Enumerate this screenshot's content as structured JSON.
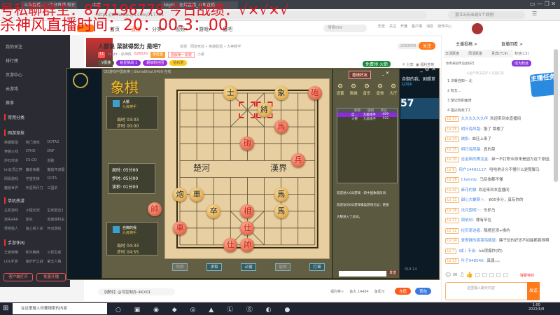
{
  "browser": {
    "tabs": [
      "斗鱼直播 - 一个好直播 就在斗鱼",
      "收藏",
      "Night - 在线直播_斗鱼直播"
    ],
    "url": "https://www.douyu.com/217785",
    "search_placeholder": "浙江6天出现5个病例"
  },
  "overlay": {
    "line1": "号私聊群主：877196778  今日战绩：√×√×√",
    "line2": "杀神风直播时间：20：00-3：00"
  },
  "site": {
    "nav": [
      "首页",
      "直播",
      "分类▾",
      "视频▾",
      "游戏▾",
      "鱼吧"
    ],
    "search_placeholder": "搜索666",
    "icons": [
      "历史",
      "关注",
      "开播",
      "客户端",
      "消息",
      "创作中心"
    ]
  },
  "sidebar": {
    "items": [
      "我的关注",
      "排行榜",
      "页游中心",
      "云游戏",
      "赛事"
    ],
    "sections": [
      {
        "title": "常用分类",
        "more": "展开"
      },
      {
        "title": "网游竞技",
        "more": "全部",
        "items": [
          "英雄联盟",
          "热门游戏",
          "DOTA2",
          "穿越火线",
          "CFHD",
          "DNF",
          "炉石传说",
          "CS:GO",
          "逃跑",
          "lol云顶之弈",
          "魔兽争霸",
          "魔兽怀旧服",
          "网易游戏",
          "守望先锋",
          "DOTA",
          "魔兽世界",
          "天涯明月刀",
          "三国杀"
        ]
      },
      {
        "title": "单机热游",
        "more": "全部",
        "items": [
          "主机游戏",
          "小程无间",
          "生死狙击2",
          "迷失ARK",
          "迷失",
          "逃离塔科夫",
          "怪物猎人",
          "海上捞人杀",
          "怀旧游戏"
        ]
      },
      {
        "title": "手游休闲",
        "more": "全部",
        "items": [
          "王者荣耀",
          "和平精英",
          "火影忍者",
          "LOL手游",
          "金铲铲之战",
          "第五人格"
        ]
      }
    ],
    "buttons": [
      "客户端打开",
      "批量开播"
    ]
  },
  "streamer": {
    "title": "人都说 菜就得努力 是吧？",
    "tag": "举报",
    "category": "网游竞技 • 英雄联盟 • 大神教学",
    "level": "11",
    "name": "Night - 杀神风",
    "hot": "826026",
    "badges": [
      "亲密度",
      "国服第一雷霆"
    ],
    "rank": "小桌",
    "room_id": "2002649",
    "follow": "关注",
    "pills": [
      "V贵族",
      "粘星挑战 1",
      "超级粉丝团",
      "钻石票"
    ],
    "free_gift": "免费领",
    "fire": "火箭",
    "share": "分享",
    "report": "福利签到"
  },
  "chess": {
    "window_title": "QQ游戏中国象棋 | Gloria0thul.0409 在线",
    "logo": "象棋",
    "invite": "邀请好友",
    "top_player": {
      "name": "大鬃",
      "rank": "九级棋手",
      "total_label": "局时",
      "total": "03:03",
      "step_label": "步时",
      "step": "00:00"
    },
    "rules": [
      {
        "label": "局时:",
        "value": "05分00"
      },
      {
        "label": "步时:",
        "value": "05分00"
      },
      {
        "label": "读秒:",
        "value": "01分00"
      }
    ],
    "bottom_player": {
      "name": "自御的我",
      "rank": "九级棋手",
      "total_label": "局时",
      "total": "04:33",
      "step_label": "步时",
      "step": "04:55"
    },
    "river": [
      "楚河",
      "漢界"
    ],
    "captured": [
      {
        "char": "帥",
        "color": "red"
      }
    ],
    "pieces": [
      {
        "c": "士",
        "s": "black",
        "col": 3,
        "row": 0
      },
      {
        "c": "象",
        "s": "black",
        "col": 6,
        "row": 0
      },
      {
        "c": "砲",
        "s": "red",
        "col": 8,
        "row": 0
      },
      {
        "c": "將",
        "s": "black",
        "col": 5,
        "row": 1
      },
      {
        "c": "馬",
        "s": "red",
        "col": 6,
        "row": 2
      },
      {
        "c": "砲",
        "s": "red",
        "col": 4,
        "row": 3
      },
      {
        "c": "兵",
        "s": "red",
        "col": 7,
        "row": 4
      },
      {
        "c": "炮",
        "s": "black",
        "col": 0,
        "row": 6
      },
      {
        "c": "車",
        "s": "black",
        "col": 1,
        "row": 6
      },
      {
        "c": "馬",
        "s": "black",
        "col": 6,
        "row": 6
      },
      {
        "c": "卒",
        "s": "black",
        "col": 2,
        "row": 7
      },
      {
        "c": "相",
        "s": "red",
        "col": 4,
        "row": 7
      },
      {
        "c": "馬",
        "s": "black",
        "col": 6,
        "row": 7
      },
      {
        "c": "車",
        "s": "red",
        "col": 0,
        "row": 8
      },
      {
        "c": "仕",
        "s": "red",
        "col": 4,
        "row": 8
      },
      {
        "c": "仕",
        "s": "red",
        "col": 3,
        "row": 9
      },
      {
        "c": "帥",
        "s": "red",
        "col": 4,
        "row": 9
      }
    ],
    "last_move": [
      {
        "col": 4,
        "row": 1
      },
      {
        "col": 5,
        "row": 1
      }
    ],
    "buttons": [
      {
        "label": "悔棋",
        "enabled": false
      },
      {
        "label": "求和",
        "enabled": true
      },
      {
        "label": "认输",
        "enabled": true
      },
      {
        "label": "催棋",
        "enabled": false
      },
      {
        "label": "打谱",
        "enabled": true
      }
    ],
    "tools": [
      "设置",
      "商城",
      "音乐",
      "音效",
      "大厅"
    ],
    "table_headers": [
      "昵称",
      "级别",
      "积分"
    ],
    "players": [
      {
        "name": "自...",
        "rank": "九级棋手",
        "score": "-409"
      },
      {
        "name": "大鬃",
        "rank": "九级棋手",
        "score": "-502"
      }
    ],
    "messages": [
      "欢迎进入QQ游戏 - 新中国象棋房间",
      "欢迎访问QQ游戏棋类游戏论坛：链接",
      "大鬃进入了房间。"
    ],
    "send": "发送"
  },
  "lol": {
    "friend": "自御的我、剧踢草",
    "status": "队列中",
    "timer": "57",
    "footer": "918.14"
  },
  "chat": {
    "top": [
      "主播投稿 >",
      "直播回看 >"
    ],
    "tabs": [
      "日活跃度",
      "周活跃度",
      "贵宾(719)",
      "粉丝(13)"
    ],
    "rank_title": "你用来陪伴追星排行",
    "rank_btn": "成为粉丝",
    "rank_note": "斗鱼严禁未成年人充值打赏",
    "ranks": [
      "冷暖自知~ 北",
      "有五...",
      "渐记你的面肯",
      "指尖有余了2"
    ],
    "messages": [
      {
        "lv": "LV 37",
        "name": "久久久久久久伴",
        "text": "欢迎来到本直播间"
      },
      {
        "lv": "LV 25",
        "name": "明日海风路:",
        "text": "服了 跳楼了"
      },
      {
        "lv": "LV 23",
        "name": "映影:",
        "text": "血压上来了"
      },
      {
        "lv": "LV 25",
        "name": "明日海风路:",
        "text": "真的菜"
      },
      {
        "lv": "LV 20",
        "name": "吉金陷的腾龙金:",
        "text": "弟一不打职业原来是因为这个原因，我还以为是身体原因"
      },
      {
        "lv": "LV 9",
        "name": "用户14481117:",
        "text": "哈哈他计分不懂什么是蹩脚马"
      },
      {
        "lv": "LV 28",
        "name": "Chaindy:",
        "text": "马后炮都不懂"
      },
      {
        "lv": "LV 42",
        "name": "麻花的猫",
        "text": "欢迎来到本直播间"
      },
      {
        "lv": "LV 11",
        "name": "甜心大螺萝卜:",
        "text": "-800多分，真有你的"
      },
      {
        "lv": "LV 26",
        "name": "法月固明丶:",
        "text": "车抓马"
      },
      {
        "lv": "LV 21",
        "name": "周依利:",
        "text": "哪有卒位"
      },
      {
        "lv": "LV 12",
        "name": "拉历奇迹者:",
        "text": "隔墙豆须+换约"
      },
      {
        "lv": "LV 24",
        "name": "爱摩狮的喜喜鸡贩鼠:",
        "text": "瞎子玩的好还不如能都喜得啊"
      },
      {
        "lv": "LV 7",
        "name": "i成丿不余:",
        "text": "lck很爆炸(的)"
      },
      {
        "lv": "LV 13",
        "name": "叶子948540:",
        "text": "真弱。。。"
      }
    ],
    "input_placeholder": "这里输入聊天内容",
    "send": "发送",
    "gift_btn": "弹幕特效",
    "task": "主播任务"
  },
  "bottom": {
    "notice": "【通知】@可控制办-4KX01",
    "stats": [
      "福利券>",
      "鱼丸 14484",
      "鱼翅 0"
    ],
    "recharge": "充值",
    "back": "背包"
  },
  "taskbar": {
    "search_placeholder": "在这里输入你要搜索的内容",
    "time": "1:00",
    "date": "2022/6/8"
  },
  "colors": {
    "douyu_orange": "#ff7a1a",
    "overlay_red": "#e0141e",
    "selection_purple": "#8a2be2"
  }
}
